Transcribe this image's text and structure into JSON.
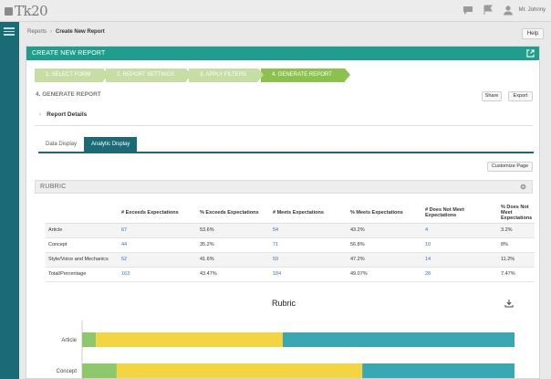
{
  "app": {
    "logo_text": "Tk20",
    "user_name": "Mr. Johnny"
  },
  "breadcrumb": {
    "parent": "Reports",
    "separator": "›",
    "current": "Create New Report"
  },
  "help_label": "Help",
  "panel": {
    "title": "CREATE NEW REPORT",
    "steps": [
      {
        "label": "1. SELECT FORM",
        "active": false
      },
      {
        "label": "2. REPORT SETTINGS",
        "active": false
      },
      {
        "label": "3. APPLY FILTERS",
        "active": false
      },
      {
        "label": "4. GENERATE REPORT",
        "active": true
      }
    ],
    "section_title": "4. GENERATE REPORT",
    "share_label": "Share",
    "export_label": "Export",
    "report_details_label": "Report Details",
    "tabs": [
      {
        "label": "Data Display",
        "active": false
      },
      {
        "label": "Analytic Display",
        "active": true
      }
    ],
    "customize_label": "Customize Page",
    "rubric_label": "RUBRIC"
  },
  "table": {
    "headers": [
      "",
      "# Exceeds Expectations",
      "% Exceeds Expectations",
      "# Meets Expectations",
      "% Meets Expectations",
      "# Does Not Meet Expectations",
      "% Does Not Meet Expectations"
    ],
    "rows": [
      [
        "Article",
        "67",
        "53.6%",
        "54",
        "43.2%",
        "4",
        "3.2%"
      ],
      [
        "Concept",
        "44",
        "35.2%",
        "71",
        "56.8%",
        "10",
        "8%"
      ],
      [
        "Style/Voice and Mechanics",
        "52",
        "41.6%",
        "59",
        "47.2%",
        "14",
        "11.2%"
      ],
      [
        "Total/Percentage",
        "163",
        "43.47%",
        "184",
        "49.07%",
        "28",
        "7.47%"
      ]
    ]
  },
  "colors": {
    "does_not_meet": "#8dc96a",
    "meets": "#f2d541",
    "exceeds": "#3aa8b3",
    "teal": "#1b6b77",
    "header_green": "#1f9e8d"
  },
  "chart_data": {
    "type": "bar",
    "orientation": "horizontal",
    "stacked": true,
    "title": "Rubric",
    "categories": [
      "Article",
      "Concept"
    ],
    "series": [
      {
        "values": [
          3.2,
          8.0
        ]
      },
      {
        "values": [
          43.2,
          56.8
        ]
      },
      {
        "values": [
          53.6,
          35.2
        ]
      }
    ],
    "xlim": [
      0,
      100
    ]
  }
}
